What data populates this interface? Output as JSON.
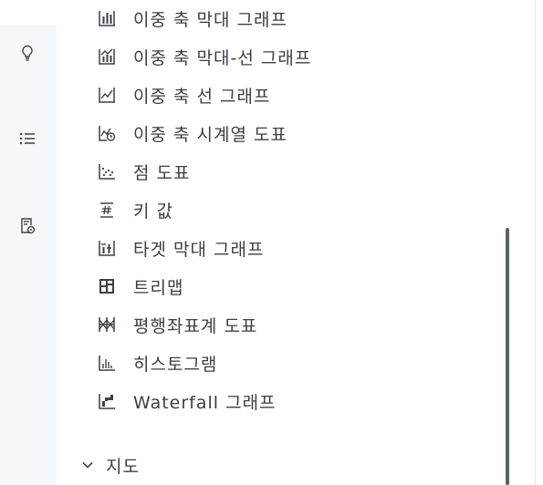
{
  "rail": {
    "items": [
      {
        "icon": "lightbulb-icon"
      },
      {
        "icon": "list-icon"
      },
      {
        "icon": "document-settings-icon"
      }
    ]
  },
  "chart_types": [
    {
      "label": "이중 축 막대 그래프",
      "icon": "dual-axis-bar-chart-icon"
    },
    {
      "label": "이중 축 막대-선 그래프",
      "icon": "dual-axis-bar-line-chart-icon"
    },
    {
      "label": "이중 축 선 그래프",
      "icon": "dual-axis-line-chart-icon"
    },
    {
      "label": "이중 축 시계열 도표",
      "icon": "dual-axis-time-series-icon"
    },
    {
      "label": "점 도표",
      "icon": "scatter-plot-icon"
    },
    {
      "label": "키 값",
      "icon": "key-value-icon"
    },
    {
      "label": "타겟 막대 그래프",
      "icon": "target-bar-chart-icon"
    },
    {
      "label": "트리맵",
      "icon": "treemap-icon"
    },
    {
      "label": "평행좌표계 도표",
      "icon": "parallel-coordinates-icon"
    },
    {
      "label": "히스토그램",
      "icon": "histogram-icon"
    },
    {
      "label": "Waterfall 그래프",
      "icon": "waterfall-chart-icon"
    }
  ],
  "section": {
    "label": "지도",
    "icon": "chevron-down-icon"
  }
}
